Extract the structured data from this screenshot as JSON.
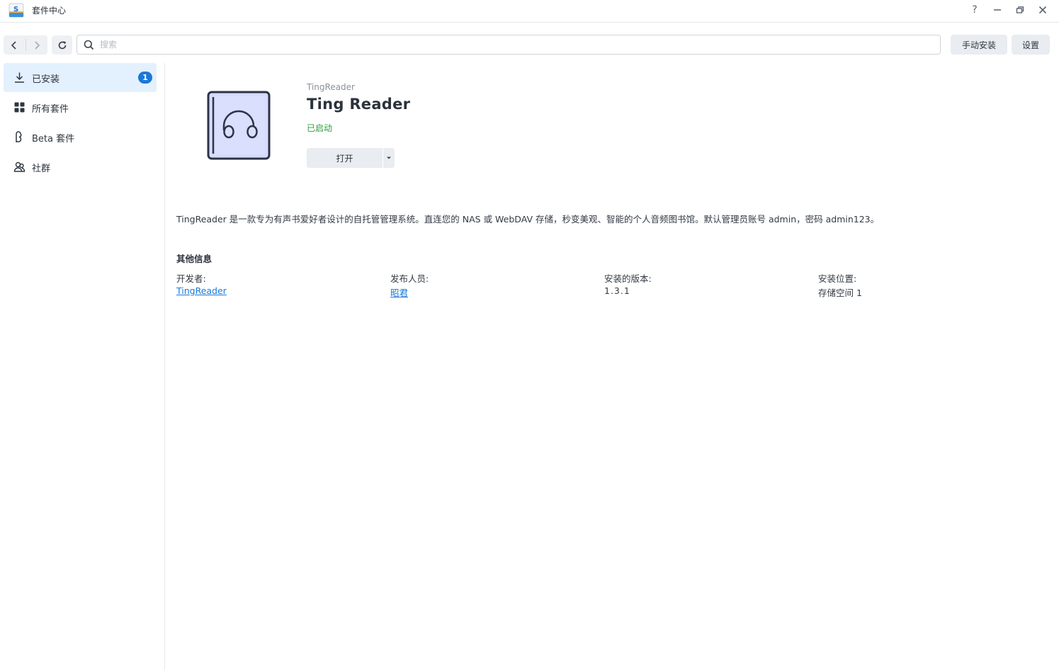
{
  "window": {
    "title": "套件中心",
    "help_glyph": "?",
    "minimize_glyph": "—",
    "close_glyph": "✕"
  },
  "toolbar": {
    "search_placeholder": "搜索",
    "manual_install_label": "手动安装",
    "settings_label": "设置"
  },
  "sidebar": {
    "items": [
      {
        "label": "已安装",
        "icon": "download-icon",
        "active": true,
        "badge": "1"
      },
      {
        "label": "所有套件",
        "icon": "grid-icon",
        "active": false
      },
      {
        "label": "Beta 套件",
        "icon": "beta-icon",
        "active": false
      },
      {
        "label": "社群",
        "icon": "community-icon",
        "active": false
      }
    ]
  },
  "package": {
    "vendor": "TingReader",
    "name": "Ting Reader",
    "status": "已启动",
    "status_color": "#2c9c3a",
    "open_label": "打开",
    "description": "TingReader 是一款专为有声书爱好者设计的自托管管理系统。直连您的 NAS 或 WebDAV 存储，秒变美观、智能的个人音频图书馆。默认管理员账号 admin，密码 admin123。",
    "icon": "headphones-book-icon"
  },
  "other_info": {
    "title": "其他信息",
    "developer_label": "开发者:",
    "developer_value": "TingReader",
    "publisher_label": "发布人员:",
    "publisher_value": "昭君",
    "version_label": "安装的版本:",
    "version_value": "1.3.1",
    "location_label": "安装位置:",
    "location_value": "存储空间 1"
  },
  "colors": {
    "accent": "#1a78d8",
    "active_bg": "#e3f0fd"
  }
}
